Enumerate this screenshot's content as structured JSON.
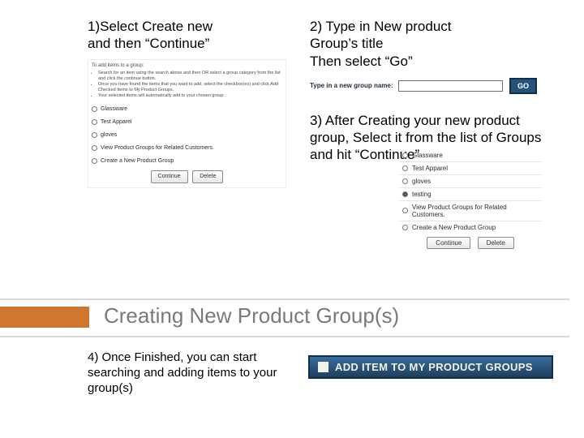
{
  "step1": {
    "heading_a": "1)Select Create new",
    "heading_b": "and then  “Continue”",
    "mini": {
      "intro": "To add items to a group:",
      "bullets": [
        "Search for an item using the search above and then OR select a group category from the list and click the continue button.",
        "Once you have found the items that you want to add, select the checkbox(es) and click Add Checked Items to My Product Groups.",
        "Your selected items will automatically add to your chosen group."
      ],
      "options": [
        "Glassware",
        "Test Apparel",
        "gloves",
        "View Product Groups for Related Customers.",
        "Create a New Product Group"
      ],
      "buttons": {
        "continue": "Continue",
        "delete": "Delete"
      }
    }
  },
  "step2": {
    "heading_a": "2) Type in New product",
    "heading_b": "Group’s title",
    "heading_c": "Then select “Go”",
    "mini": {
      "label": "Type in a new group name:",
      "go": "GO"
    }
  },
  "step3": {
    "text": "3) After Creating your new product group, Select it from the list of Groups and hit “Continue”",
    "mini": {
      "options": [
        "Glassware",
        "Test Apparel",
        "gloves",
        "testing",
        "View Product Groups for Related Customers.",
        "Create a New Product Group"
      ],
      "buttons": {
        "continue": "Continue",
        "delete": "Delete"
      }
    }
  },
  "banner": {
    "title": "Creating New Product Group(s)"
  },
  "step4": {
    "text": "4) Once Finished, you can start searching and adding items to your group(s)",
    "pill": "ADD ITEM TO MY PRODUCT GROUPS"
  }
}
